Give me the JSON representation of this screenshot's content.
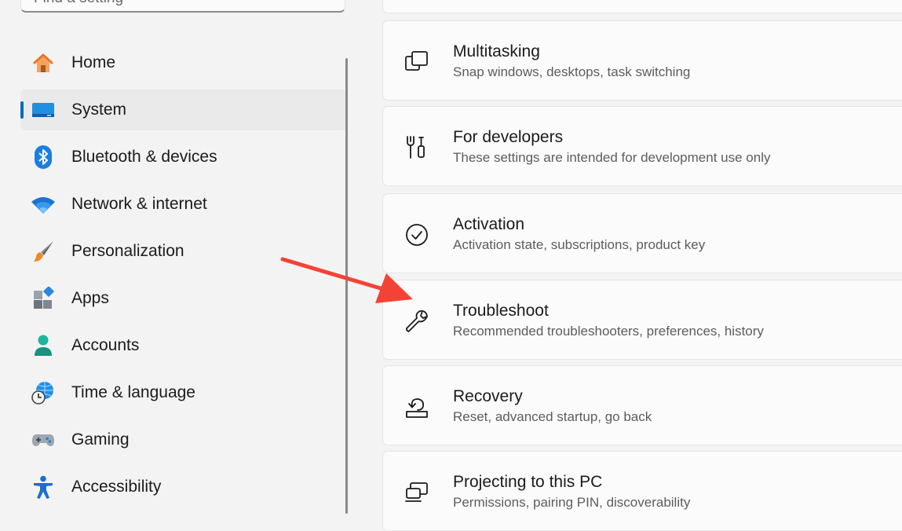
{
  "search": {
    "placeholder": "Find a setting"
  },
  "sidebar": {
    "items": [
      {
        "label": "Home",
        "icon": "home-icon"
      },
      {
        "label": "System",
        "icon": "monitor-icon",
        "selected": true
      },
      {
        "label": "Bluetooth & devices",
        "icon": "bluetooth-icon"
      },
      {
        "label": "Network & internet",
        "icon": "wifi-icon"
      },
      {
        "label": "Personalization",
        "icon": "paintbrush-icon"
      },
      {
        "label": "Apps",
        "icon": "apps-icon"
      },
      {
        "label": "Accounts",
        "icon": "person-icon"
      },
      {
        "label": "Time & language",
        "icon": "globe-clock-icon"
      },
      {
        "label": "Gaming",
        "icon": "gamepad-icon"
      },
      {
        "label": "Accessibility",
        "icon": "accessibility-icon"
      }
    ]
  },
  "main": {
    "cards": [
      {
        "title": "Multitasking",
        "description": "Snap windows, desktops, task switching",
        "icon": "multitasking-icon"
      },
      {
        "title": "For developers",
        "description": "These settings are intended for development use only",
        "icon": "developer-tools-icon"
      },
      {
        "title": "Activation",
        "description": "Activation state, subscriptions, product key",
        "icon": "check-circle-icon"
      },
      {
        "title": "Troubleshoot",
        "description": "Recommended troubleshooters, preferences, history",
        "icon": "wrench-icon"
      },
      {
        "title": "Recovery",
        "description": "Reset, advanced startup, go back",
        "icon": "recovery-icon"
      },
      {
        "title": "Projecting to this PC",
        "description": "Permissions, pairing PIN, discoverability",
        "icon": "projecting-icon"
      }
    ]
  },
  "colors": {
    "accent": "#0067c0",
    "annotation_arrow": "#f44336",
    "background": "#f3f3f3",
    "card": "#fbfbfb"
  }
}
